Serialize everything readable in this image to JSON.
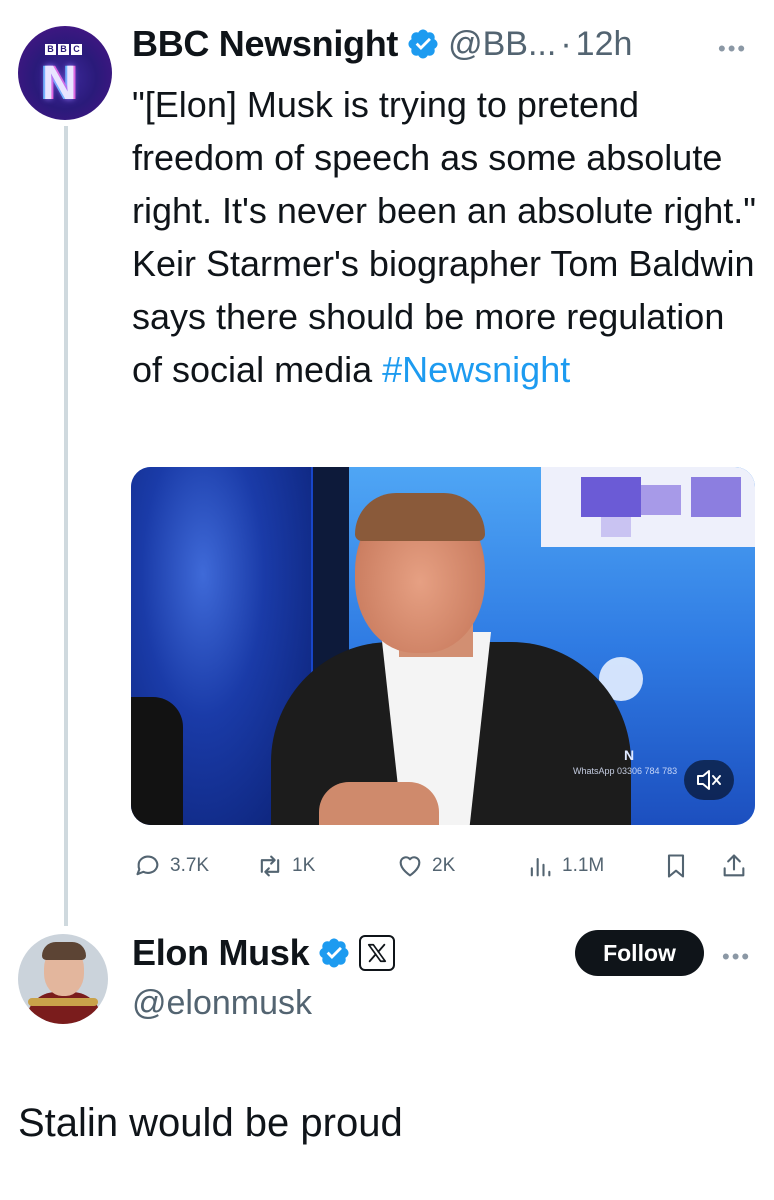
{
  "tweet1": {
    "author": {
      "name": "BBC Newsnight",
      "handle": "@BB...",
      "separator": "·",
      "time": "12h",
      "avatar_text": "BBC",
      "avatar_mark": "N"
    },
    "text_main": "\"[Elon] Musk is trying to pretend freedom of speech as some absolute right. It's never been an absolute right.\" Keir Starmer's biographer Tom Baldwin says there should be more regulation of social media ",
    "hashtag": "#Newsnight",
    "video": {
      "watermark": "WhatsApp 03306 784 783",
      "muted": true
    },
    "actions": {
      "replies": "3.7K",
      "reposts": "1K",
      "likes": "2K",
      "views": "1.1M"
    }
  },
  "tweet2": {
    "author": {
      "name": "Elon Musk",
      "handle": "@elonmusk"
    },
    "follow_label": "Follow",
    "text": "Stalin would be proud"
  },
  "colors": {
    "link": "#1d9bf0",
    "verified": "#1d9bf0",
    "text": "#0f1419",
    "secondary": "#536471",
    "thread_line": "#cfd9de"
  },
  "icons": [
    "verified-badge-icon",
    "more-icon",
    "reply-icon",
    "repost-icon",
    "like-icon",
    "views-icon",
    "bookmark-icon",
    "share-icon",
    "mute-icon",
    "x-logo-icon"
  ]
}
